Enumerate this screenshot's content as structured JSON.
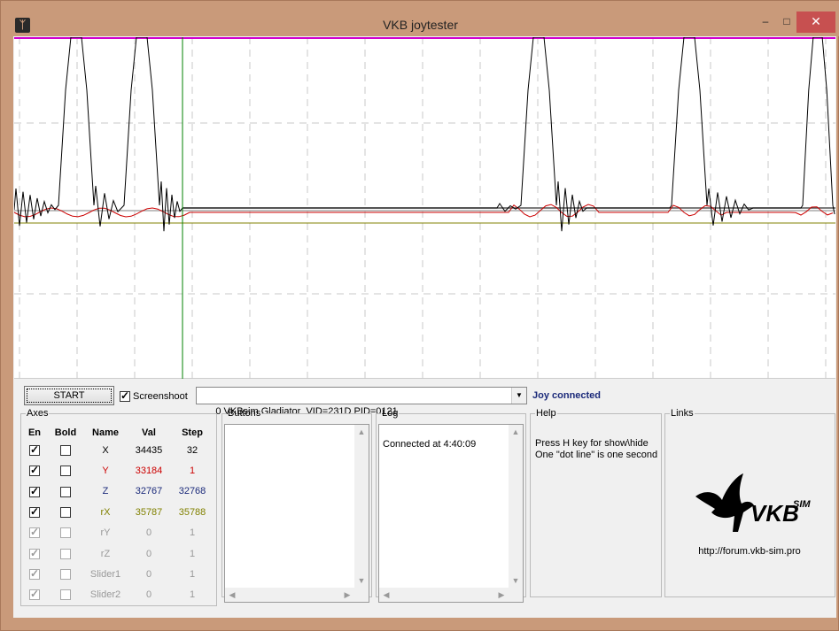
{
  "window": {
    "title": "VKB joytester",
    "minimize": "–",
    "maximize": "□",
    "close": "✕",
    "icon": "vkb-app-icon"
  },
  "plot": {
    "colors": {
      "top_line": "#d000d0",
      "cursor_line": "#008000",
      "x_trace": "#000000",
      "y_trace": "#cc0000",
      "ref_line_dark": "#505050",
      "ref_line_gray": "#aaaaaa",
      "ref_line_olive": "#808000",
      "grid": "#c8c8c8"
    }
  },
  "toolbar": {
    "start_label": "START",
    "screenshoot_label": "Screenshoot",
    "screenshoot_checked": true,
    "device_value": "0 VKBsim Gladiator  VID=231D PID=0121",
    "status": "Joy connected",
    "status_color": "#1b2a7a"
  },
  "axes": {
    "legend": "Axes",
    "headers": {
      "en": "En",
      "bold": "Bold",
      "name": "Name",
      "val": "Val",
      "step": "Step"
    },
    "rows": [
      {
        "en": true,
        "bold": false,
        "name": "X",
        "val": "34435",
        "step": "32",
        "color": "#000000",
        "enabled": true
      },
      {
        "en": true,
        "bold": false,
        "name": "Y",
        "val": "33184",
        "step": "1",
        "color": "#cc0000",
        "enabled": true
      },
      {
        "en": true,
        "bold": false,
        "name": "Z",
        "val": "32767",
        "step": "32768",
        "color": "#1b2a7a",
        "enabled": true
      },
      {
        "en": true,
        "bold": false,
        "name": "rX",
        "val": "35787",
        "step": "35788",
        "color": "#808000",
        "enabled": true
      },
      {
        "en": true,
        "bold": false,
        "name": "rY",
        "val": "0",
        "step": "1",
        "color": "#999999",
        "enabled": false
      },
      {
        "en": true,
        "bold": false,
        "name": "rZ",
        "val": "0",
        "step": "1",
        "color": "#999999",
        "enabled": false
      },
      {
        "en": true,
        "bold": false,
        "name": "Slider1",
        "val": "0",
        "step": "1",
        "color": "#999999",
        "enabled": false
      },
      {
        "en": true,
        "bold": false,
        "name": "Slider2",
        "val": "0",
        "step": "1",
        "color": "#999999",
        "enabled": false
      }
    ]
  },
  "buttons_panel": {
    "legend": "Buttons"
  },
  "log_panel": {
    "legend": "Log",
    "lines": [
      "Connected at 4:40:09"
    ]
  },
  "help_panel": {
    "legend": "Help",
    "line1": "Press H key for show\\hide",
    "line2": "One \"dot line\" is one second"
  },
  "links_panel": {
    "legend": "Links",
    "logo_text": "VKB",
    "logo_sup": "SIM",
    "url": "http://forum.vkb-sim.pro"
  }
}
